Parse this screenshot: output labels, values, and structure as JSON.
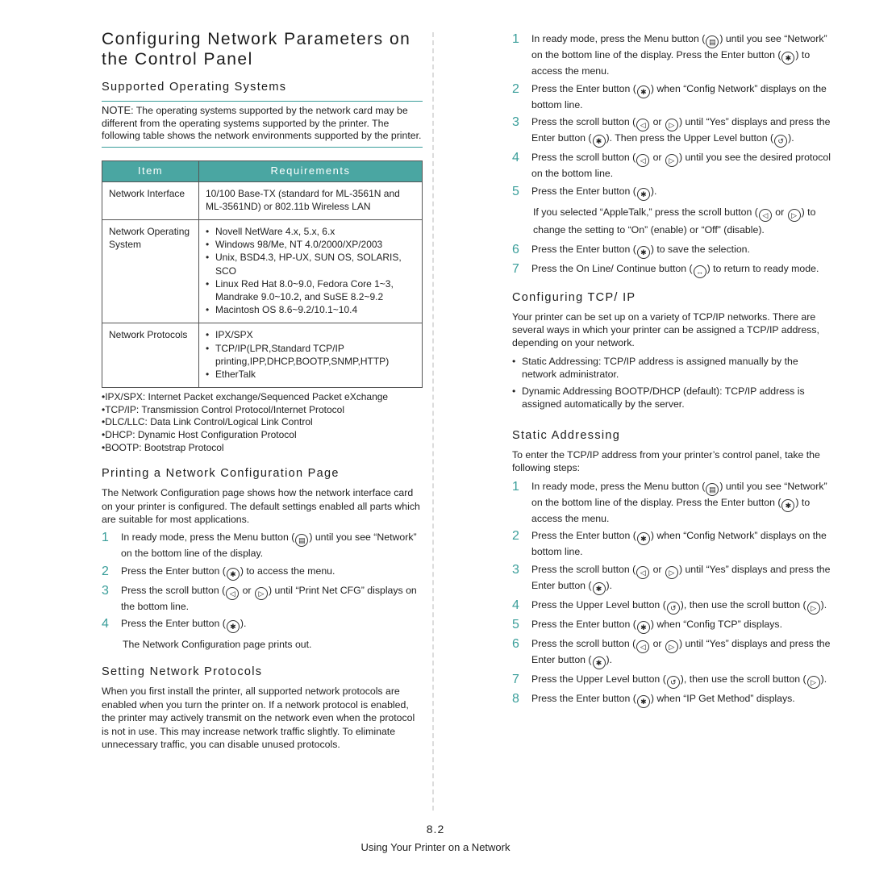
{
  "title": "Configuring Network Parameters on the Control Panel",
  "supported_os": {
    "heading": "Supported Operating Systems",
    "note_label": "NOTE",
    "note_text": ": The operating systems supported by the network card may be different from the operating systems supported by the printer. The following table shows the network environments supported by the printer.",
    "table": {
      "headers": [
        "Item",
        "Requirements"
      ],
      "rows": [
        {
          "item": "Network Interface",
          "text": "10/100 Base-TX (standard for ML-3561N and ML-3561ND) or 802.11b Wireless LAN",
          "bullets": []
        },
        {
          "item": "Network Operating System",
          "text": "",
          "bullets": [
            "Novell NetWare 4.x, 5.x, 6.x",
            "Windows 98/Me, NT 4.0/2000/XP/2003",
            "Unix, BSD4.3, HP-UX, SUN OS, SOLARIS, SCO",
            "Linux Red Hat 8.0~9.0, Fedora Core 1~3, Mandrake 9.0~10.2, and SuSE 8.2~9.2",
            "Macintosh OS 8.6~9.2/10.1~10.4"
          ]
        },
        {
          "item": "Network Protocols",
          "text": "",
          "bullets": [
            "IPX/SPX",
            "TCP/IP(LPR,Standard TCP/IP printing,IPP,DHCP,BOOTP,SNMP,HTTP)",
            "EtherTalk"
          ]
        }
      ]
    },
    "abbreviations": [
      "•IPX/SPX: Internet Packet exchange/Sequenced Packet eXchange",
      "•TCP/IP: Transmission Control Protocol/Internet Protocol",
      "•DLC/LLC: Data Link Control/Logical Link Control",
      "•DHCP: Dynamic Host Configuration Protocol",
      "•BOOTP: Bootstrap Protocol"
    ]
  },
  "print_config": {
    "heading": "Printing a Network Configuration Page",
    "intro": "The Network Configuration page shows how the network interface card on your printer is configured. The default settings enabled all parts which are suitable for most applications.",
    "steps": [
      {
        "num": "1",
        "parts": [
          "In ready mode, press the Menu button (",
          "menu",
          ") until you see “Network” on the bottom line of the display."
        ]
      },
      {
        "num": "2",
        "parts": [
          "Press the Enter button (",
          "enter",
          ") to access the menu."
        ]
      },
      {
        "num": "3",
        "parts": [
          "Press the scroll button (",
          "left",
          " or ",
          "right",
          ") until “Print Net CFG” displays on the bottom line."
        ]
      },
      {
        "num": "4",
        "parts": [
          "Press the Enter button (",
          "enter",
          ")."
        ]
      }
    ],
    "result": "The Network Configuration page prints out."
  },
  "set_protocols": {
    "heading": "Setting Network Protocols",
    "text": "When you first install the printer, all supported network protocols are enabled when you turn the printer on. If a network protocol is enabled, the printer may actively transmit on the network even when the protocol is not in use. This may increase network traffic slightly. To eliminate unnecessary traffic, you can disable unused protocols."
  },
  "protocol_steps": [
    {
      "num": "1",
      "parts": [
        "In ready mode, press the Menu button (",
        "menu",
        ") until you see “Network” on the bottom line of the display. Press the Enter button (",
        "enter",
        ") to access the menu."
      ]
    },
    {
      "num": "2",
      "parts": [
        "Press the Enter button (",
        "enter",
        ") when “Config Network” displays on the bottom line."
      ]
    },
    {
      "num": "3",
      "parts": [
        "Press the scroll button (",
        "left",
        " or ",
        "right",
        ") until “Yes” displays and press the Enter button (",
        "enter",
        "). Then press the Upper Level button (",
        "upper",
        ")."
      ]
    },
    {
      "num": "4",
      "parts": [
        "Press the scroll button (",
        "left",
        " or ",
        "right",
        ") until you see the desired protocol on the bottom line."
      ]
    },
    {
      "num": "5",
      "parts": [
        "Press the Enter button (",
        "enter",
        ")."
      ]
    }
  ],
  "appletalk_note": [
    "If you selected “AppleTalk,” press the scroll button (",
    "left",
    " or ",
    "right",
    ") to change the setting to “On” (enable) or “Off” (disable)."
  ],
  "protocol_steps_2": [
    {
      "num": "6",
      "parts": [
        "Press the Enter button (",
        "enter",
        ") to save the selection."
      ]
    },
    {
      "num": "7",
      "parts": [
        "Press the On Line/ Continue button (",
        "online",
        ") to return to ready mode."
      ]
    }
  ],
  "tcpip": {
    "heading": "Configuring TCP/ IP",
    "intro": "Your printer can be set up on a variety of TCP/IP networks. There are several ways in which your printer can be assigned a TCP/IP address, depending on your network.",
    "bullets": [
      "Static Addressing: TCP/IP address is assigned manually by the network administrator.",
      "Dynamic Addressing BOOTP/DHCP (default): TCP/IP address is assigned automatically by the server."
    ]
  },
  "static": {
    "heading": "Static Addressing",
    "intro": "To enter the TCP/IP address from your printer’s control panel, take the following steps:",
    "steps": [
      {
        "num": "1",
        "parts": [
          "In ready mode, press the Menu button (",
          "menu",
          ") until you see “Network” on the bottom line of the display. Press the Enter button (",
          "enter",
          ") to access the menu."
        ]
      },
      {
        "num": "2",
        "parts": [
          "Press the Enter button (",
          "enter",
          ") when “Config Network” displays on the bottom line."
        ]
      },
      {
        "num": "3",
        "parts": [
          "Press the scroll button (",
          "left",
          " or ",
          "right",
          ") until “Yes” displays and press the Enter button (",
          "enter",
          ")."
        ]
      },
      {
        "num": "4",
        "parts": [
          "Press the Upper Level button (",
          "upper",
          "), then use the scroll button (",
          "right",
          ")."
        ]
      },
      {
        "num": "5",
        "parts": [
          "Press the Enter button (",
          "enter",
          ") when “Config TCP” displays."
        ]
      },
      {
        "num": "6",
        "parts": [
          "Press the scroll button (",
          "left",
          " or ",
          "right",
          ") until “Yes” displays and press the Enter button (",
          "enter",
          ")."
        ]
      },
      {
        "num": "7",
        "parts": [
          "Press the Upper Level button (",
          "upper",
          "), then use the scroll button  (",
          "right",
          ")."
        ]
      },
      {
        "num": "8",
        "parts": [
          "Press the Enter button (",
          "enter",
          ") when “IP Get Method” displays."
        ]
      }
    ]
  },
  "icons": {
    "menu": {
      "glyph": "▤",
      "name": "menu-button-icon"
    },
    "enter": {
      "glyph": "✱",
      "name": "enter-button-icon"
    },
    "left": {
      "glyph": "◁",
      "name": "scroll-left-icon"
    },
    "right": {
      "glyph": "▷",
      "name": "scroll-right-icon"
    },
    "upper": {
      "glyph": "↺",
      "name": "upper-level-icon"
    },
    "online": {
      "glyph": "↔",
      "name": "online-continue-icon"
    }
  },
  "footer": {
    "page_number": "8.2",
    "chapter": "Using Your Printer on a Network"
  },
  "colors": {
    "accent": "#3a9e9a",
    "table_header": "#4aa6a2"
  }
}
